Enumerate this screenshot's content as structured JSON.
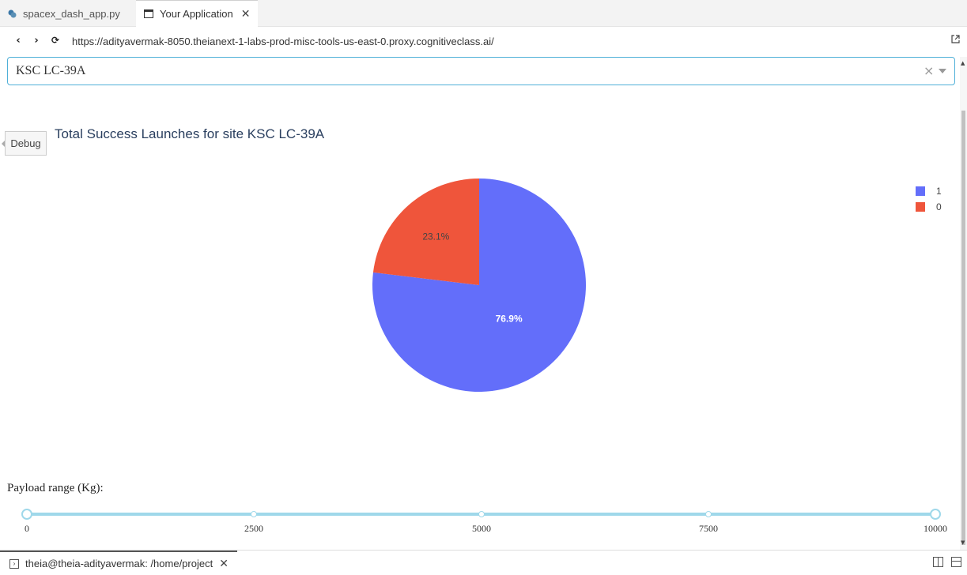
{
  "tabs": [
    {
      "label": "spacex_dash_app.py",
      "icon": "python-icon",
      "active": false
    },
    {
      "label": "Your Application",
      "icon": "browser-window-icon",
      "active": true
    }
  ],
  "browser": {
    "url": "https://adityavermak-8050.theianext-1-labs-prod-misc-tools-us-east-0.proxy.cognitiveclass.ai/"
  },
  "dropdown": {
    "value": "KSC LC-39A",
    "clear_symbol": "×"
  },
  "debug": {
    "label": "Debug"
  },
  "chart_data": {
    "type": "pie",
    "title": "Total Success Launches for site KSC LC-39A",
    "labels": [
      "1",
      "0"
    ],
    "values": [
      76.9,
      23.1
    ],
    "value_labels": [
      "76.9%",
      "23.1%"
    ],
    "colors": [
      "#636efa",
      "#ef553b"
    ],
    "legend_position": "top-right"
  },
  "payload": {
    "label": "Payload range (Kg):",
    "min": 0,
    "max": 10000,
    "selected": [
      0,
      10000
    ],
    "marks": [
      "0",
      "2500",
      "5000",
      "7500",
      "10000"
    ]
  },
  "terminal": {
    "label": "theia@theia-adityavermak: /home/project"
  },
  "colors": {
    "accent": "#4fb0d8",
    "slider": "#9fd8ea"
  }
}
